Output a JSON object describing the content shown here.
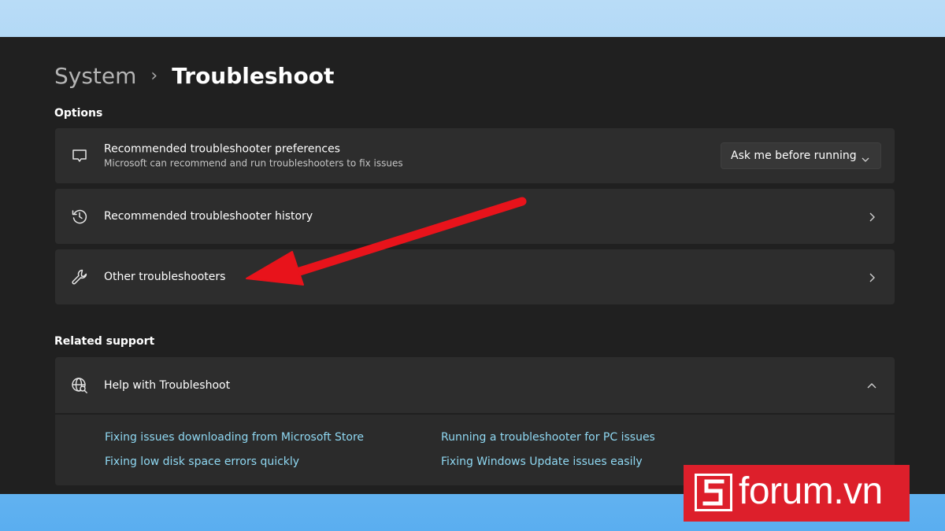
{
  "breadcrumb": {
    "parent": "System",
    "separator": "›",
    "current": "Troubleshoot"
  },
  "sections": {
    "options": "Options",
    "related": "Related support"
  },
  "cards": {
    "preferences": {
      "title": "Recommended troubleshooter preferences",
      "description": "Microsoft can recommend and run troubleshooters to fix issues",
      "dropdown_value": "Ask me before running",
      "icon": "chat-bubble-icon"
    },
    "history": {
      "title": "Recommended troubleshooter history",
      "icon": "history-icon"
    },
    "other": {
      "title": "Other troubleshooters",
      "icon": "wrench-icon"
    }
  },
  "help": {
    "title": "Help with Troubleshoot",
    "icon": "globe-search-icon",
    "links": [
      "Fixing issues downloading from Microsoft Store",
      "Running a troubleshooter for PC issues",
      "Fixing low disk space errors quickly",
      "Fixing Windows Update issues easily"
    ]
  },
  "watermark": {
    "mark": "S",
    "text": "forum.vn"
  },
  "colors": {
    "accent_link": "#8fd8f2",
    "annotation_arrow": "#e8131b",
    "brand_red": "#dd1f2b",
    "card_bg": "#2d2d2d",
    "window_bg": "#202020"
  }
}
